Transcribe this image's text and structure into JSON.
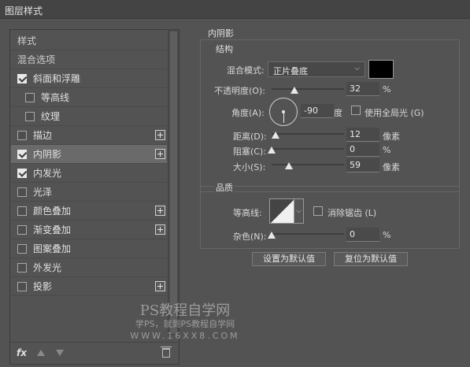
{
  "window": {
    "title": "图层样式"
  },
  "styles_list": {
    "header_label": "样式",
    "blend_options_label": "混合选项",
    "items": [
      {
        "label": "斜面和浮雕",
        "checked": true,
        "plus": false,
        "indent": false
      },
      {
        "label": "等高线",
        "checked": false,
        "plus": false,
        "indent": true
      },
      {
        "label": "纹理",
        "checked": false,
        "plus": false,
        "indent": true
      },
      {
        "label": "描边",
        "checked": false,
        "plus": true,
        "indent": false
      },
      {
        "label": "内阴影",
        "checked": true,
        "plus": true,
        "indent": false,
        "selected": true
      },
      {
        "label": "内发光",
        "checked": true,
        "plus": false,
        "indent": false
      },
      {
        "label": "光泽",
        "checked": false,
        "plus": false,
        "indent": false
      },
      {
        "label": "颜色叠加",
        "checked": false,
        "plus": true,
        "indent": false
      },
      {
        "label": "渐变叠加",
        "checked": false,
        "plus": true,
        "indent": false
      },
      {
        "label": "图案叠加",
        "checked": false,
        "plus": false,
        "indent": false
      },
      {
        "label": "外发光",
        "checked": false,
        "plus": false,
        "indent": false
      },
      {
        "label": "投影",
        "checked": false,
        "plus": true,
        "indent": false
      }
    ],
    "bottom_icons": [
      "fx-icon",
      "move-up-icon",
      "move-down-icon",
      "trash-icon"
    ],
    "fx_label": "fx"
  },
  "inner_shadow": {
    "section_title": "内阴影",
    "structure": {
      "title": "结构",
      "blend_mode_label": "混合模式:",
      "blend_mode_value": "正片叠底",
      "color": "#000000",
      "opacity_label": "不透明度(O):",
      "opacity_value": "32",
      "opacity_unit": "%",
      "opacity_level": 0.32,
      "angle_label": "角度(A):",
      "angle_value": "-90",
      "angle_unit": "度",
      "global_light_label": "使用全局光 (G)",
      "global_light_checked": false,
      "distance_label": "距离(D):",
      "distance_value": "12",
      "distance_unit": "像素",
      "distance_level": 0.05,
      "choke_label": "阻塞(C):",
      "choke_value": "0",
      "choke_unit": "%",
      "choke_level": 0.0,
      "size_label": "大小(S):",
      "size_value": "59",
      "size_unit": "像素",
      "size_level": 0.24
    },
    "quality": {
      "title": "品质",
      "contour_label": "等高线:",
      "antialias_label": "消除锯齿 (L)",
      "antialias_checked": false,
      "noise_label": "杂色(N):",
      "noise_value": "0",
      "noise_unit": "%",
      "noise_level": 0.0
    },
    "buttons": {
      "make_default": "设置为默认值",
      "reset_default": "复位为默认值"
    }
  },
  "watermark": {
    "line1": "PS教程自学网",
    "line2": "学PS，就到PS教程自学网",
    "line3": "WWW.16XX8.COM"
  }
}
